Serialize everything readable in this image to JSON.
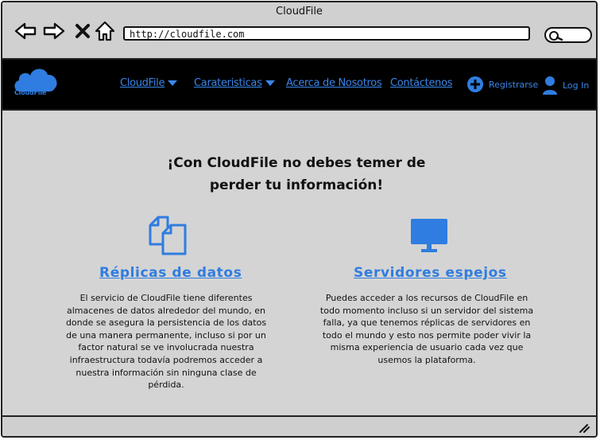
{
  "window": {
    "title": "CloudFile"
  },
  "browser": {
    "url": "http://cloudfile.com",
    "icons": [
      "back-arrow-icon",
      "forward-arrow-icon",
      "close-x-icon",
      "home-icon",
      "search-icon"
    ]
  },
  "nav": {
    "logo_text": "CloudFile",
    "links": [
      {
        "label": "CloudFile",
        "dropdown": true
      },
      {
        "label": "Carateristicas",
        "dropdown": true
      },
      {
        "label": "Acerca de Nosotros",
        "dropdown": false
      },
      {
        "label": "Contáctenos",
        "dropdown": false
      }
    ],
    "register_label": "Registrarse",
    "login_label": "Log In"
  },
  "main": {
    "headline_line1": "¡Con CloudFile no debes temer de",
    "headline_line2": "perder tu información!",
    "features": [
      {
        "icon": "copy-files-icon",
        "title": "Réplicas de datos",
        "lines": [
          "El servicio de CloudFile tiene diferentes",
          "almacenes de datos alrededor del mundo, en",
          "donde se asegura la persistencia de los datos",
          "de una manera permanente, incluso si por un",
          "factor natural se ve involucrada nuestra",
          "infraestructura todavía podremos acceder a",
          "nuestra información sin ninguna clase de",
          "pérdida."
        ]
      },
      {
        "icon": "monitor-icon",
        "title": "Servidores espejos ",
        "lines": [
          "Puedes acceder a los recursos de CloudFile en",
          "todo momento incluso si un servidor del sistema",
          "falla, ya que tenemos réplicas de servidores en",
          "todo el mundo y esto nos permite poder vivir la",
          "misma experiencia de usuario cada vez que",
          "usemos la plataforma."
        ]
      }
    ]
  },
  "colors": {
    "accent": "#2f7de0",
    "navbar": "#000000",
    "content_bg": "#d4d4d4"
  }
}
